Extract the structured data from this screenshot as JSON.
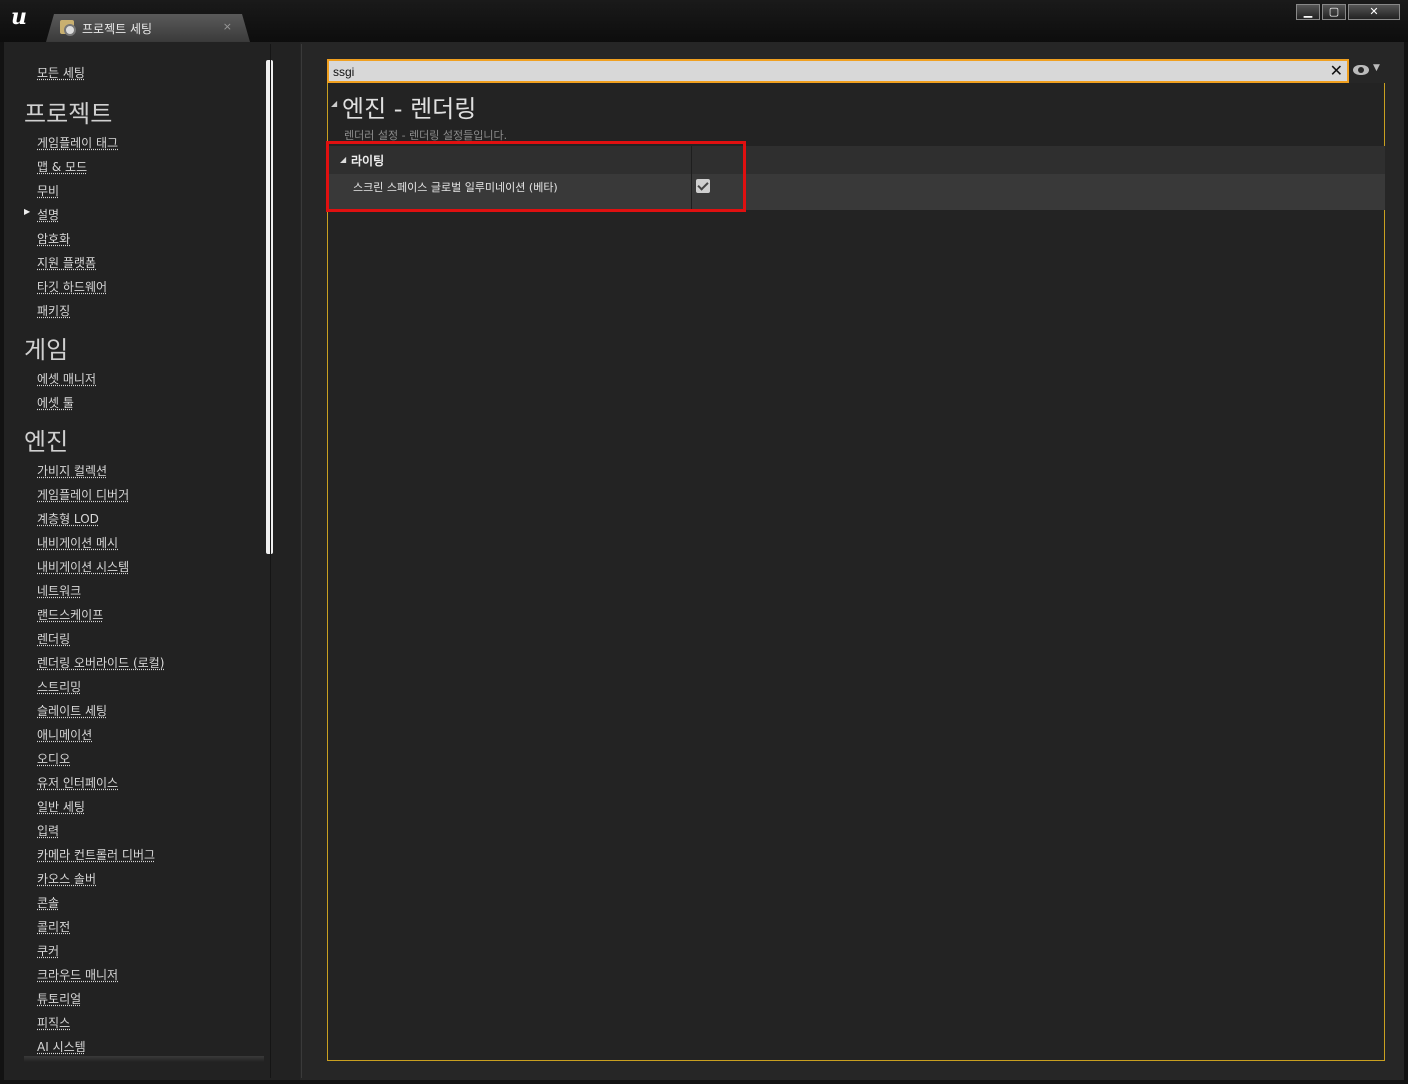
{
  "window": {
    "tab_label": "프로젝트 세팅",
    "tab_close": "×",
    "controls": {
      "minimize": "▁",
      "maximize": "▢",
      "close": "✕"
    }
  },
  "sidebar": {
    "all_settings": "모든 세팅",
    "sections": [
      {
        "header": "프로젝트",
        "items": [
          "게임플레이 태그",
          "맵 & 모드",
          "무비",
          "설명",
          "암호화",
          "지원 플랫폼",
          "타깃 하드웨어",
          "패키징"
        ]
      },
      {
        "header": "게임",
        "items": [
          "에셋 매니저",
          "에셋 툴"
        ]
      },
      {
        "header": "엔진",
        "items": [
          "가비지 컬렉션",
          "게임플레이 디버거",
          "계층형 LOD",
          "내비게이션 메시",
          "내비게이션 시스템",
          "네트워크",
          "랜드스케이프",
          "렌더링",
          "렌더링 오버라이드 (로컬)",
          "스트리밍",
          "슬레이트 세팅",
          "애니메이션",
          "오디오",
          "유저 인터페이스",
          "일반 세팅",
          "입력",
          "카메라 컨트롤러 디버그",
          "카오스 솔버",
          "콘솔",
          "콜리전",
          "쿠커",
          "크라우드 매니저",
          "튜토리얼",
          "피직스",
          "AI 시스템"
        ]
      }
    ],
    "active_item": "설명"
  },
  "search": {
    "value": "ssgi",
    "clear": "✕"
  },
  "content": {
    "section_title": "엔진 - 렌더링",
    "section_description": "렌더러 설정 - 렌더링 설정들입니다.",
    "category": "라이팅",
    "property_label": "스크린 스페이스 글로벌 일루미네이션 (베타)",
    "property_checked": true
  },
  "colors": {
    "search_border": "#f0a020",
    "highlight": "#e01010"
  }
}
